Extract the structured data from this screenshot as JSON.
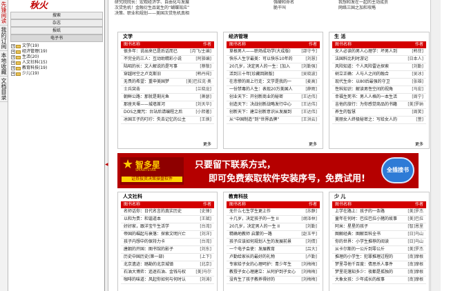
{
  "app": {
    "logo_text": "秋火",
    "vtabs": [
      "先锋阅读",
      "我的订阅",
      "本地收藏",
      "文档目录"
    ]
  },
  "left": {
    "buttons": [
      "搜索",
      "杂志",
      "报纸",
      "电子书"
    ],
    "tree": [
      {
        "sign": "+",
        "label": "文学(19)"
      },
      {
        "sign": "+",
        "label": "经济管理(19)"
      },
      {
        "sign": "+",
        "label": "生活(20)"
      },
      {
        "sign": "+",
        "label": "人文社科(15)"
      },
      {
        "sign": "+",
        "label": "教育科技(19)"
      },
      {
        "sign": "+",
        "label": "少儿(19)"
      }
    ]
  },
  "top": {
    "col1": [
      "研究院院长：宏观经济学、自由化与发展",
      "次贷危机！金融衍生品诞生的“蝴蝶效应”",
      "决策、职业和规划——美国次贷危机真相"
    ],
    "col2": [
      "强硬和命名",
      "脆干叫"
    ],
    "col3": [
      "我想和发在一起的主动成员",
      "网络三国之加和攻略"
    ]
  },
  "panels": [
    {
      "title": "文学",
      "head": [
        "图书名称",
        "作者"
      ],
      "rows": [
        [
          "很多年：说出来已是后话而已",
          "[月飞/主编]"
        ],
        [
          "不完全的三人：互动助精彩小说",
          "[阿骆编]"
        ],
        [
          "陆昭的长：文人解说的是写事",
          "[蔡敬]"
        ],
        [
          "穿越时空之卢克斯旧",
          "[韩丹闯]"
        ],
        [
          "无畏的希望：重申美国梦",
          "[美]巴拉克·奥"
        ],
        [
          "士兵突击",
          "[兰晓龙]"
        ],
        [
          "朝鲜公路：那就是剩光鱼",
          "[萧瑟]"
        ],
        [
          "那座天堰——城墙首河",
          "[刘天华]"
        ],
        [
          "DOS之魔咒：台站后请编程之后",
          "[小熙著]"
        ],
        [
          "冰国王子的叮咛：失去记忆的公主",
          "[王焕]"
        ]
      ],
      "more": "更多"
    },
    {
      "title": "经济管理",
      "head": [
        "图书名称",
        "作者"
      ],
      "rows": [
        [
          "草根男人——职场成功学(大成版)",
          "[邵守今]"
        ],
        [
          "快乐人生字最美：可以快乐10年的",
          "[刘慧]"
        ],
        [
          "20几岁，决定男人的一生：[加入",
          "[刘勤强]"
        ],
        [
          "活到三十年[珍藏回顾版]",
          "[吴晓波]"
        ],
        [
          "在悲惨的周上行走：文学是我的一",
          "[麦高]"
        ],
        [
          "一份禁毒的人生：表现20万美国人",
          "[薛雨]"
        ],
        [
          "创业天下：开创新商业的秘密",
          "[王达伟]"
        ],
        [
          "创造天下：决战创新战略发行中心",
          "[王达伟]"
        ],
        [
          "创新天下：建立创新意识从发展到",
          "[王达伟]"
        ],
        [
          "从“中国制造”到“世界品牌”",
          "[王洪云]"
        ]
      ],
      "more": "更多"
    },
    {
      "title": "生 活",
      "head": [
        "图书名称",
        "作者"
      ],
      "rows": [
        [
          "女人必读的男人心理学：坏男人到",
          "[韩菲]"
        ],
        [
          "法国料比利时游记",
          "[日本人]"
        ],
        [
          "风险知道：个人风险雷达探索",
          "[刘勤]"
        ],
        [
          "树立正确：人与人之间的融合",
          "[吴冰]"
        ],
        [
          "现代生命：以80后最强的守卫",
          "[张雄]"
        ],
        [
          "性科知识：解读男性空间的视角",
          "[马宏]"
        ],
        [
          "幸福生死书：男人人格的一本生活",
          "[周宁]"
        ],
        [
          "吉他的旅行：为你感觉商品的书籍",
          "[美]罗纳"
        ],
        [
          "养生的智慧",
          "[周笑]"
        ],
        [
          "美丽女人终极秘密之：写给女人的",
          "[萱]"
        ]
      ],
      "more": "更多"
    },
    {
      "title": "人文社科",
      "head": [
        "图书名称",
        "作者"
      ],
      "rows": [
        [
          "名师话你：日代名言的真实历史",
          "[史锋]"
        ],
        [
          "以和为贵：和谐道本",
          "[王斌]"
        ],
        [
          "好好家，跟洋宝牛生活学",
          "[台湾]"
        ],
        [
          "帝国的崛起与衰落：探索文明兴亡",
          "[刘洋]"
        ],
        [
          "孩子内想中的保持力卡",
          "[台湾]"
        ],
        [
          "唐朝的开国：图书馆的影子",
          "[刘东]"
        ],
        [
          "历史中国历史(第一部)",
          "[上下]"
        ],
        [
          "北京遗迹：踏勘的北京城镇",
          "[北京]"
        ],
        [
          "石油大博弈：追逐石油、金钱与权",
          "[美]马尔"
        ],
        [
          "咖啡的味道：风起你如何与何时认",
          "[刘涛]"
        ]
      ],
      "more": "更多"
    },
    {
      "title": "教育科技",
      "head": [
        "图书名称",
        "作者"
      ],
      "rows": [
        [
          "无什么七生学生更上作",
          "[苏静]"
        ],
        [
          "十几岁，决定孩子的一生 II",
          "[胡泽林]"
        ],
        [
          "20几岁，决定男人的一生 II",
          "[刘勤]"
        ],
        [
          "精确地教师 启蒙的一路",
          "[赵玉平]"
        ],
        [
          "孩子应该如何规划人生的发展前景",
          "[刘倩]"
        ],
        [
          "一个电子会使：发展教育",
          "[吕大]"
        ],
        [
          "卢勤给家长的最好的礼物",
          "[卢勤]"
        ],
        [
          "专家给子女的心理呵护：青少年生",
          "[刘梅梅]"
        ],
        [
          "教授子女心理建立：从阿护到子女心",
          "[刘梅梅]"
        ],
        [
          "没有生了孩子教养得好的",
          "[刘梅梅]"
        ]
      ],
      "more": "更多"
    },
    {
      "title": "少 儿",
      "head": [
        "图书名称",
        "作者"
      ],
      "rows": [
        [
          "上学在路上：孩子的一条路",
          "[美]罗杰"
        ],
        [
          "童年在何时：巴拉巴拉小猪的故事",
          "[美]巴拉"
        ],
        [
          "阿米：星星的孩子",
          "[智]恩里"
        ],
        [
          "图解经典：图解百科全书",
          "[日]乌山"
        ],
        [
          "你的世界：小学生推荐的阅读",
          "[日]乌山"
        ],
        [
          "从卡尔斯的一公斤到零公斤",
          "[美]罗杰"
        ],
        [
          "推理的小学生：犯罪推理过程的",
          "[南]摩根"
        ],
        [
          "梦里寻他千百度：倩思杀人事件",
          "[南]摩根"
        ],
        [
          "梦里花落知多少：夜都是孤独的",
          "[南]摩根"
        ],
        [
          "大象女孩：少年成长的故事",
          "[南]摩根"
        ]
      ],
      "more": "更多"
    }
  ],
  "banner": {
    "brand": "智多星",
    "brand_en": "SMARTSTAR",
    "sub": "证券投资决策操盘软件",
    "line1": "只要留下联系方式，",
    "line2": "即可免费索取软件安装序号，免费试用!",
    "button": "全插搜书"
  }
}
